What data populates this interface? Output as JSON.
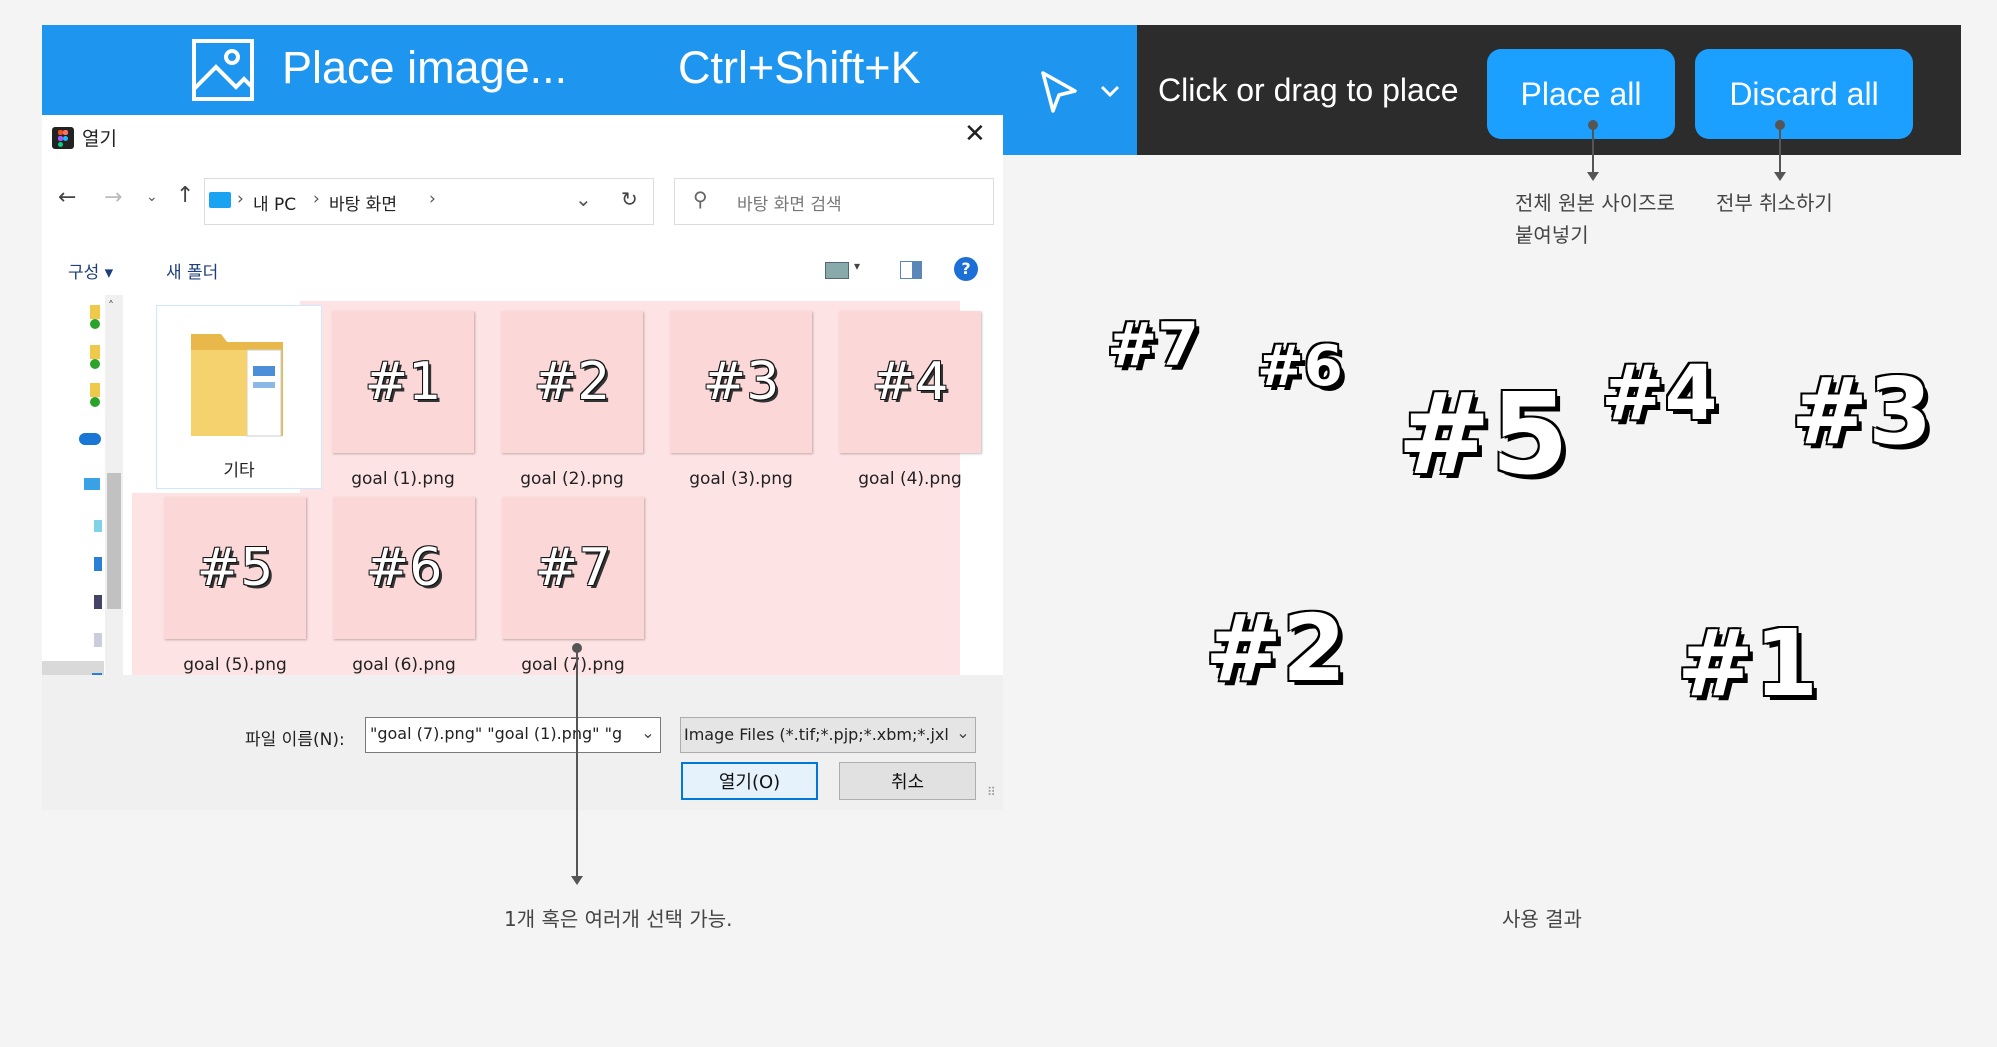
{
  "menu_item": {
    "label": "Place image...",
    "shortcut": "Ctrl+Shift+K",
    "icon": "image-icon"
  },
  "toolbar": {
    "hint": "Click or drag to place",
    "place_all": "Place all",
    "discard_all": "Discard all",
    "tool_icon": "cursor-arrow-icon"
  },
  "dialog": {
    "title": "열기",
    "breadcrumb": [
      "내 PC",
      "바탕 화면"
    ],
    "search_placeholder": "바탕 화면 검색",
    "organize": "구성",
    "new_folder": "새 폴더",
    "folder": "기타",
    "files": [
      {
        "thumb": "#1",
        "name": "goal (1).png"
      },
      {
        "thumb": "#2",
        "name": "goal (2).png"
      },
      {
        "thumb": "#3",
        "name": "goal (3).png"
      },
      {
        "thumb": "#4",
        "name": "goal (4).png"
      },
      {
        "thumb": "#5",
        "name": "goal (5).png"
      },
      {
        "thumb": "#6",
        "name": "goal (6).png"
      },
      {
        "thumb": "#7",
        "name": "goal (7).png"
      }
    ],
    "filename_label": "파일 이름(N):",
    "filename_value": "\"goal (7).png\" \"goal (1).png\" \"g",
    "filetype": "Image Files (*.tif;*.pjp;*.xbm;*.jxl",
    "open_button": "열기(O)",
    "cancel_button": "취소"
  },
  "annotations": {
    "place_all_note": "전체 원본 사이즈로\n붙여넣기",
    "discard_all_note": "전부 취소하기",
    "multi_select_note": "1개 혹은 여러개 선택 가능.",
    "result_note": "사용 결과"
  },
  "canvas_result": [
    "#7",
    "#6",
    "#5",
    "#4",
    "#3",
    "#2",
    "#1"
  ]
}
